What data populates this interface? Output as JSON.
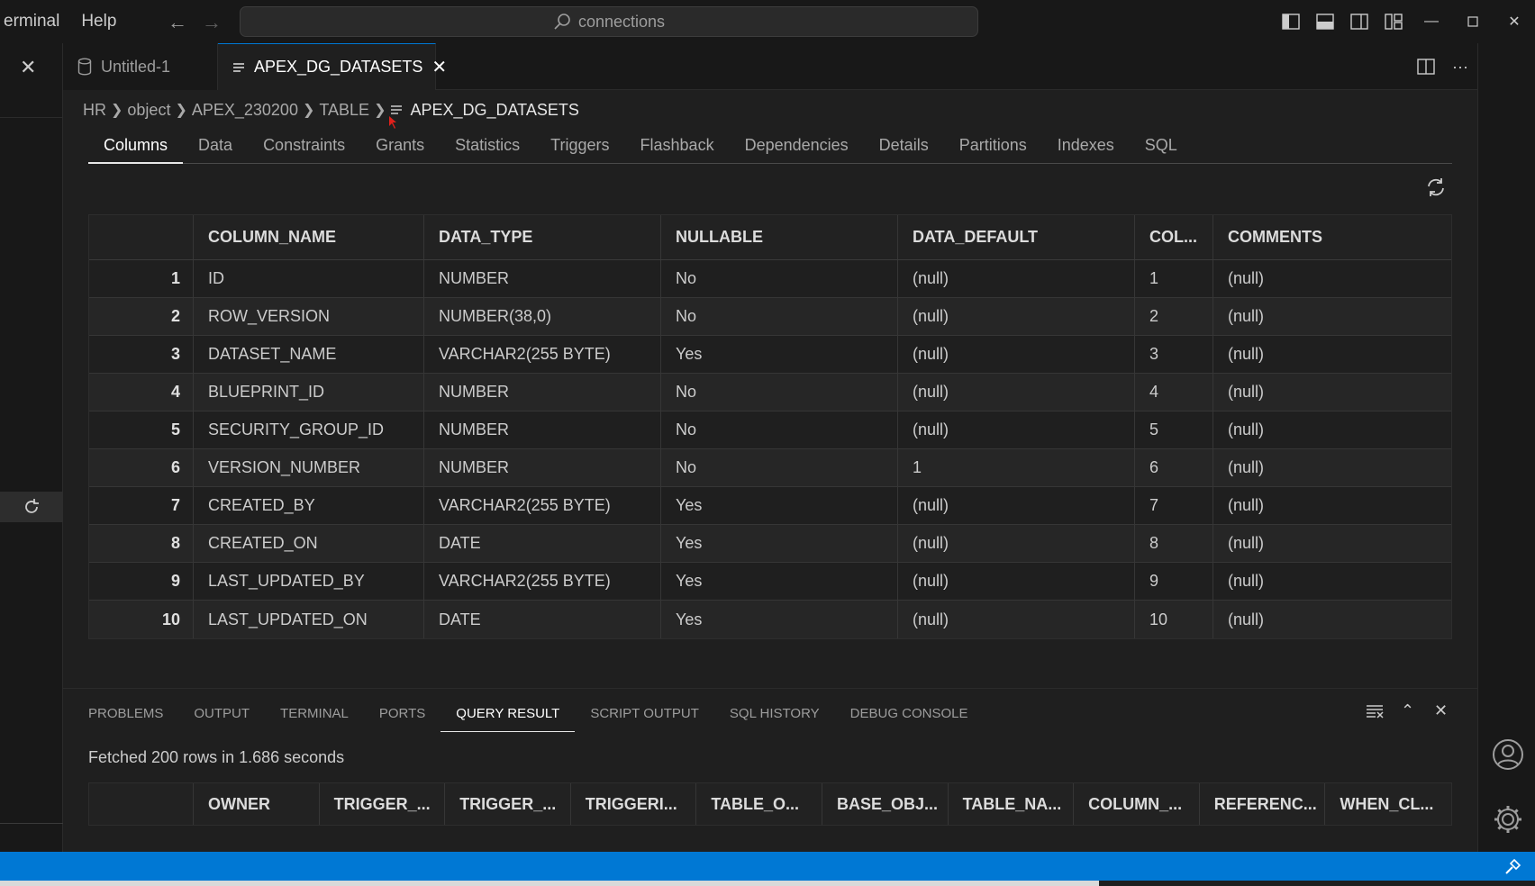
{
  "menu": [
    "erminal",
    "Help"
  ],
  "command_center": {
    "text": "connections"
  },
  "tabs": [
    {
      "label": "Untitled-1"
    },
    {
      "label": "APEX_DG_DATASETS"
    }
  ],
  "breadcrumb": [
    "HR",
    "object",
    "APEX_230200",
    "TABLE",
    "APEX_DG_DATASETS"
  ],
  "subtabs": [
    "Columns",
    "Data",
    "Constraints",
    "Grants",
    "Statistics",
    "Triggers",
    "Flashback",
    "Dependencies",
    "Details",
    "Partitions",
    "Indexes",
    "SQL"
  ],
  "grid": {
    "headers": [
      "",
      "COLUMN_NAME",
      "DATA_TYPE",
      "NULLABLE",
      "DATA_DEFAULT",
      "COL...",
      "COMMENTS"
    ],
    "rows": [
      [
        "1",
        "ID",
        "NUMBER",
        "No",
        "(null)",
        "1",
        "(null)"
      ],
      [
        "2",
        "ROW_VERSION",
        "NUMBER(38,0)",
        "No",
        "(null)",
        "2",
        "(null)"
      ],
      [
        "3",
        "DATASET_NAME",
        "VARCHAR2(255 BYTE)",
        "Yes",
        "(null)",
        "3",
        "(null)"
      ],
      [
        "4",
        "BLUEPRINT_ID",
        "NUMBER",
        "No",
        "(null)",
        "4",
        "(null)"
      ],
      [
        "5",
        "SECURITY_GROUP_ID",
        "NUMBER",
        "No",
        "(null)",
        "5",
        "(null)"
      ],
      [
        "6",
        "VERSION_NUMBER",
        "NUMBER",
        "No",
        "1",
        "6",
        "(null)"
      ],
      [
        "7",
        "CREATED_BY",
        "VARCHAR2(255 BYTE)",
        "Yes",
        "(null)",
        "7",
        "(null)"
      ],
      [
        "8",
        "CREATED_ON",
        "DATE",
        "Yes",
        "(null)",
        "8",
        "(null)"
      ],
      [
        "9",
        "LAST_UPDATED_BY",
        "VARCHAR2(255 BYTE)",
        "Yes",
        "(null)",
        "9",
        "(null)"
      ],
      [
        "10",
        "LAST_UPDATED_ON",
        "DATE",
        "Yes",
        "(null)",
        "10",
        "(null)"
      ]
    ]
  },
  "panel": {
    "tabs": [
      "PROBLEMS",
      "OUTPUT",
      "TERMINAL",
      "PORTS",
      "QUERY RESULT",
      "SCRIPT OUTPUT",
      "SQL HISTORY",
      "DEBUG CONSOLE"
    ],
    "active_tab": "QUERY RESULT",
    "status": "Fetched 200 rows in 1.686 seconds",
    "headers": [
      "OWNER",
      "TRIGGER_...",
      "TRIGGER_...",
      "TRIGGERI...",
      "TABLE_O...",
      "BASE_OBJ...",
      "TABLE_NA...",
      "COLUMN_...",
      "REFERENC...",
      "WHEN_CL..."
    ]
  },
  "colors": {
    "accent": "#0078d4",
    "background": "#1f1f1f",
    "chrome": "#181818"
  }
}
